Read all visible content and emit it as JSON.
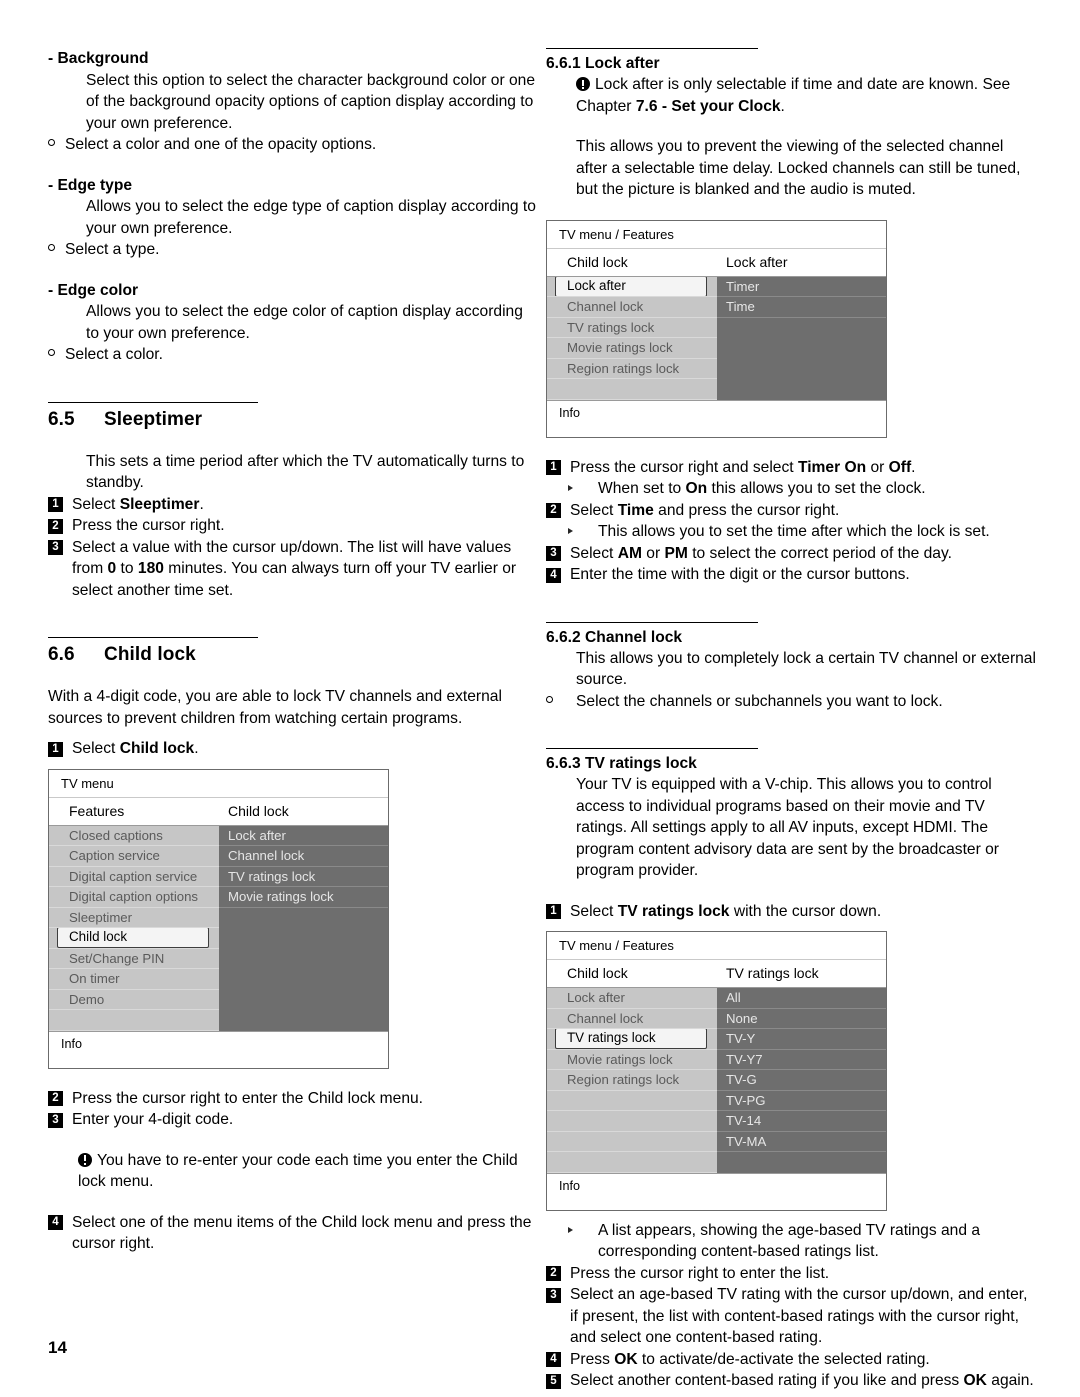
{
  "page": {
    "folio": "14"
  },
  "left_column": {
    "background": {
      "title": "- Background",
      "body": "Select this option to select the character background color or one of the background opacity options of caption display according to your own preference.",
      "bullet": "Select a color and one of the opacity options."
    },
    "edge_type": {
      "title": "- Edge type",
      "body": "Allows you to select the edge type of caption display according to your own preference.",
      "bullet": "Select a type."
    },
    "edge_color": {
      "title": "- Edge color",
      "body": "Allows you to select the edge color of caption display according to your own preference.",
      "bullet": "Select a color."
    },
    "sleeptimer": {
      "number": "6.5",
      "title": "Sleeptimer",
      "intro": "This sets a time period after which the TV automatically turns to standby.",
      "steps": [
        {
          "n": "1",
          "html": "Select <b>Sleeptimer</b>."
        },
        {
          "n": "2",
          "html": "Press the cursor right."
        },
        {
          "n": "3",
          "html": "Select a value with the cursor up/down. The list will have values from <b>0</b> to <b>180</b> minutes. You can always turn off your TV earlier or select another time set."
        }
      ]
    },
    "child_lock": {
      "number": "6.6",
      "title": "Child lock",
      "intro": "With a 4-digit code, you are able to lock TV channels and external sources to prevent children from watching certain programs.",
      "step1": {
        "n": "1",
        "html": "Select <b>Child lock</b>."
      },
      "step2": {
        "n": "2",
        "html": "Press the cursor right to enter the Child lock menu."
      },
      "step3": {
        "n": "3",
        "html": "Enter your 4-digit code."
      },
      "note": "You have to re-enter your code each time you enter the Child lock menu.",
      "step4": {
        "n": "4",
        "html": "Select one of the menu items of the Child lock menu and press the cursor right."
      }
    },
    "menu_diagram": {
      "breadcrumb": "TV menu",
      "header_left": "Features",
      "header_right": "Child lock",
      "left_items": [
        "Closed captions",
        "Caption service",
        "Digital caption service",
        "Digital caption options",
        "Sleeptimer",
        "Child lock",
        "Set/Change PIN",
        "On timer",
        "Demo"
      ],
      "selected_left": "Child lock",
      "right_items": [
        "Lock after",
        "Channel lock",
        "TV ratings lock",
        "Movie ratings lock"
      ],
      "right_blank_count": 5,
      "footer": "Info"
    }
  },
  "right_column": {
    "lock_after": {
      "number": "6.6.1",
      "title": "Lock after",
      "note_html": "Lock after is only selectable if time and date are known. See Chapter <b>7.6 - Set your Clock</b>.",
      "body": "This allows you to prevent the viewing of the selected channel after a selectable time delay. Locked channels can still be tuned, but the picture is blanked and the audio is muted.",
      "steps": [
        {
          "type": "num",
          "n": "1",
          "html": "Press the cursor right and select <b>Timer On</b> or <b>Off</b>."
        },
        {
          "type": "tri",
          "html": "When set to <b>On</b> this allows you to set the clock."
        },
        {
          "type": "num",
          "n": "2",
          "html": "Select <b>Time</b> and press the cursor right."
        },
        {
          "type": "tri",
          "html": "This allows you to set the time after which the lock is set."
        },
        {
          "type": "num",
          "n": "3",
          "html": "Select <b>AM</b> or <b>PM</b> to select the correct period of the day."
        },
        {
          "type": "num",
          "n": "4",
          "html": "Enter the time with the digit or the cursor buttons."
        }
      ]
    },
    "lock_after_diagram": {
      "breadcrumb": "TV menu / Features",
      "header_left": "Child lock",
      "header_right": "Lock after",
      "left_items": [
        "Lock after",
        "Channel lock",
        "TV ratings lock",
        "Movie ratings lock",
        "Region ratings lock"
      ],
      "selected_left": "Lock after",
      "right_items": [
        "Timer",
        "Time"
      ],
      "right_blank_count": 3,
      "footer": "Info"
    },
    "channel_lock": {
      "number": "6.6.2",
      "title": "Channel lock",
      "body": "This allows you to completely lock a certain TV channel or external source.",
      "bullet": "Select the channels or subchannels you want to lock."
    },
    "tv_ratings_lock": {
      "number": "6.6.3",
      "title": "TV ratings lock",
      "body": "Your TV is equipped with a V-chip. This allows you to control access to individual programs based on their movie and TV ratings. All settings apply to all AV inputs, except HDMI. The program content advisory data are sent by the broadcaster or program provider.",
      "step1": {
        "n": "1",
        "html": "Select <b>TV ratings lock</b> with the cursor down."
      },
      "steps_after": [
        {
          "type": "tri",
          "html": "A list appears, showing the age-based TV ratings and a corresponding content-based ratings list."
        },
        {
          "type": "num",
          "n": "2",
          "html": "Press the cursor right to enter the list."
        },
        {
          "type": "num",
          "n": "3",
          "html": "Select an age-based TV rating with the cursor up/down, and enter, if present, the list with content-based ratings with the cursor right, and select one content-based rating."
        },
        {
          "type": "num",
          "n": "4",
          "html": "Press <b>OK</b> to activate/de-activate the selected rating."
        },
        {
          "type": "num",
          "n": "5",
          "html": "Select another content-based rating if you like and press <b>OK</b> again."
        }
      ]
    },
    "ratings_diagram": {
      "breadcrumb": "TV menu / Features",
      "header_left": "Child lock",
      "header_right": "TV ratings lock",
      "left_items": [
        "Lock after",
        "Channel lock",
        "TV ratings lock",
        "Movie ratings lock",
        "Region ratings lock"
      ],
      "selected_left": "TV ratings lock",
      "left_blank_count": 4,
      "right_items": [
        "All",
        "None",
        "TV-Y",
        "TV-Y7",
        "TV-G",
        "TV-PG",
        "TV-14",
        "TV-MA"
      ],
      "right_blank_count": 1,
      "footer": "Info"
    }
  },
  "colors": {
    "menu_left_bg": "#c6c6c6",
    "menu_right_bg": "#6e6e6e",
    "menu_border": "#6b6b6b",
    "selected_bg": "#f4f4f4",
    "text": "#000000"
  }
}
